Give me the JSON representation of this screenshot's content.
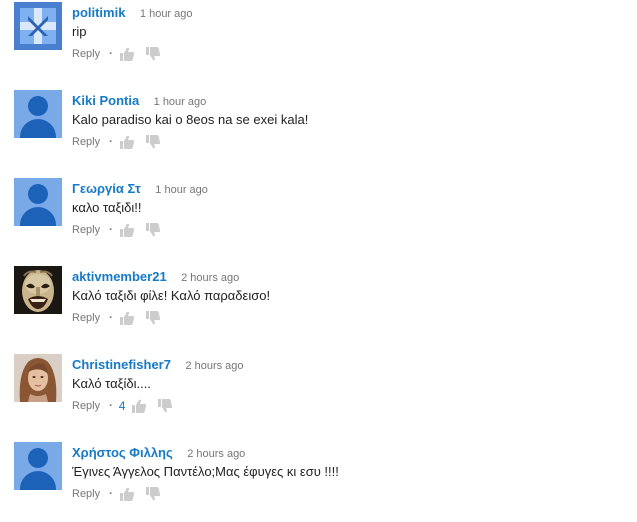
{
  "actions": {
    "reply": "Reply",
    "separator": "·"
  },
  "colors": {
    "author": "#167ac6",
    "meta": "#767676",
    "text": "#222222",
    "thumb": "#cccccc"
  },
  "comments": [
    {
      "author": "politimik",
      "time": "1 hour ago",
      "text": "rip",
      "avatar": "default-avatar",
      "likes": ""
    },
    {
      "author": "Kiki Pontia",
      "time": "1 hour ago",
      "text": "Kalo paradiso kai o 8eos na se exei kala!",
      "avatar": "default-avatar",
      "likes": ""
    },
    {
      "author": "Γεωργία Στ",
      "time": "1 hour ago",
      "text": "καλο ταξιδι!!",
      "avatar": "default-avatar",
      "likes": ""
    },
    {
      "author": "aktivmember21",
      "time": "2 hours ago",
      "text": "Καλό ταξιδι φίλε! Καλό παραδεισο!",
      "avatar": "theater-mask-photo",
      "likes": ""
    },
    {
      "author": "Christinefisher7",
      "time": "2 hours ago",
      "text": "Καλό ταξίδι....",
      "avatar": "woman-photo",
      "likes": "4"
    },
    {
      "author": "Χρήστος Φιλλης",
      "time": "2 hours ago",
      "text": "Έγινες Άγγελος Παντέλο;Μας έφυγες κι εσυ !!!!",
      "avatar": "default-avatar",
      "likes": ""
    }
  ]
}
